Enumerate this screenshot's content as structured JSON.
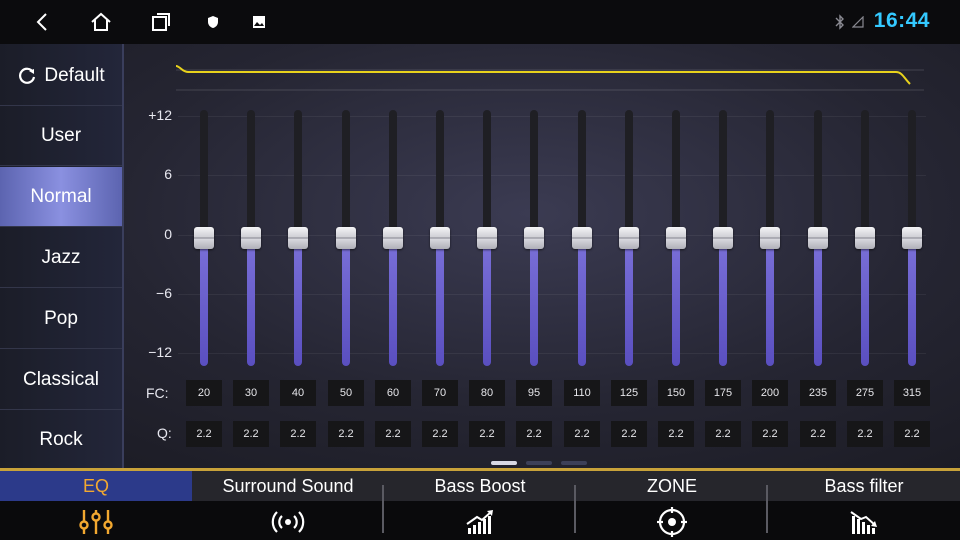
{
  "status_bar": {
    "time": "16:44",
    "icons": [
      "back-icon",
      "home-icon",
      "recent-apps-icon",
      "shield-icon",
      "image-icon",
      "bluetooth-icon",
      "signal-icon"
    ]
  },
  "sidebar": {
    "presets": [
      {
        "label": "Default",
        "icon": "refresh-icon"
      },
      {
        "label": "User"
      },
      {
        "label": "Normal",
        "active": true
      },
      {
        "label": "Jazz"
      },
      {
        "label": "Pop"
      },
      {
        "label": "Classical"
      },
      {
        "label": "Rock"
      }
    ]
  },
  "eq": {
    "scale": [
      "+12",
      "6",
      "0",
      "−6",
      "−12"
    ],
    "gain_range": [
      -12,
      12
    ],
    "fc_label": "FC:",
    "q_label": "Q:",
    "bands": [
      {
        "fc": "20",
        "q": "2.2",
        "gain": 0
      },
      {
        "fc": "30",
        "q": "2.2",
        "gain": 0
      },
      {
        "fc": "40",
        "q": "2.2",
        "gain": 0
      },
      {
        "fc": "50",
        "q": "2.2",
        "gain": 0
      },
      {
        "fc": "60",
        "q": "2.2",
        "gain": 0
      },
      {
        "fc": "70",
        "q": "2.2",
        "gain": 0
      },
      {
        "fc": "80",
        "q": "2.2",
        "gain": 0
      },
      {
        "fc": "95",
        "q": "2.2",
        "gain": 0
      },
      {
        "fc": "110",
        "q": "2.2",
        "gain": 0
      },
      {
        "fc": "125",
        "q": "2.2",
        "gain": 0
      },
      {
        "fc": "150",
        "q": "2.2",
        "gain": 0
      },
      {
        "fc": "175",
        "q": "2.2",
        "gain": 0
      },
      {
        "fc": "200",
        "q": "2.2",
        "gain": 0
      },
      {
        "fc": "235",
        "q": "2.2",
        "gain": 0
      },
      {
        "fc": "275",
        "q": "2.2",
        "gain": 0
      },
      {
        "fc": "315",
        "q": "2.2",
        "gain": 0
      }
    ],
    "pages": 3,
    "active_page": 0,
    "curve_color": "#e8d21c",
    "slider_fill_color": "#6a5fd0"
  },
  "tabs": [
    {
      "label": "EQ",
      "icon": "equalizer-icon",
      "active": true
    },
    {
      "label": "Surround Sound",
      "icon": "surround-icon"
    },
    {
      "label": "Bass Boost",
      "icon": "bass-boost-icon"
    },
    {
      "label": "ZONE",
      "icon": "zone-target-icon"
    },
    {
      "label": "Bass filter",
      "icon": "bass-filter-icon"
    }
  ],
  "colors": {
    "accent": "#34c9ff",
    "active_tab_text": "#f2a830",
    "active_preset": "#7a80d0"
  }
}
